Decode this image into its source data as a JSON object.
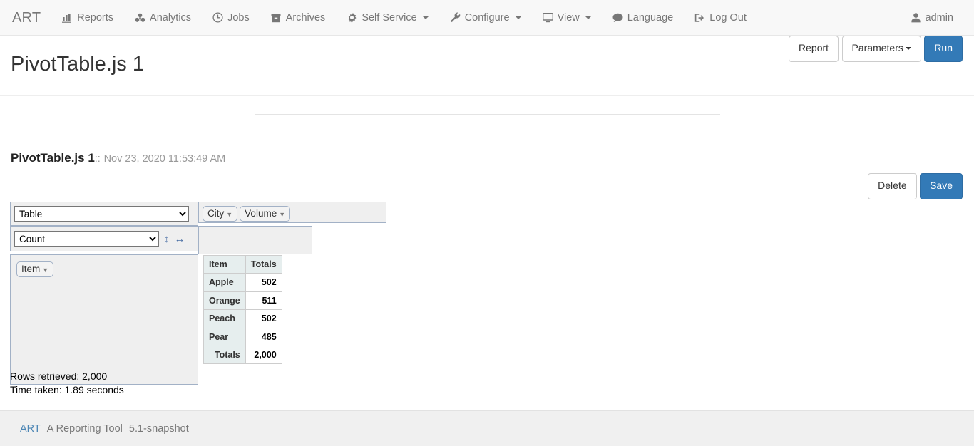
{
  "navbar": {
    "brand": "ART",
    "items": [
      {
        "label": "Reports",
        "icon": "bar-chart-icon",
        "caret": false
      },
      {
        "label": "Analytics",
        "icon": "cubes-icon",
        "caret": false
      },
      {
        "label": "Jobs",
        "icon": "clock-icon",
        "caret": false
      },
      {
        "label": "Archives",
        "icon": "archive-icon",
        "caret": false
      },
      {
        "label": "Self Service",
        "icon": "gear-icon",
        "caret": true
      },
      {
        "label": "Configure",
        "icon": "wrench-icon",
        "caret": true
      },
      {
        "label": "View",
        "icon": "desktop-icon",
        "caret": true
      },
      {
        "label": "Language",
        "icon": "comment-icon",
        "caret": false
      },
      {
        "label": "Log Out",
        "icon": "sign-out-icon",
        "caret": false
      }
    ],
    "user": {
      "label": "admin",
      "icon": "user-icon"
    }
  },
  "header": {
    "title": "PivotTable.js 1",
    "buttons": {
      "report": "Report",
      "parameters": "Parameters",
      "run": "Run"
    }
  },
  "report": {
    "name": "PivotTable.js 1",
    "separator": "::",
    "timestamp": "Nov 23, 2020 11:53:49 AM",
    "delete_label": "Delete",
    "save_label": "Save"
  },
  "pivot": {
    "renderer": {
      "selected": "Table",
      "options": [
        "Table"
      ]
    },
    "aggregator": {
      "selected": "Count",
      "options": [
        "Count"
      ]
    },
    "sort_icons": {
      "vertical": "↕",
      "horizontal": "↔"
    },
    "cols": [
      {
        "label": "City",
        "triangle": "▼"
      },
      {
        "label": "Volume",
        "triangle": "▼"
      }
    ],
    "rows": [
      {
        "label": "Item",
        "triangle": "▼"
      }
    ],
    "unused": []
  },
  "chart_data": {
    "type": "table",
    "title": "PivotTable.js 1",
    "columns": [
      "Item",
      "Totals"
    ],
    "categories": [
      "Apple",
      "Orange",
      "Peach",
      "Pear"
    ],
    "values": [
      502,
      511,
      502,
      485
    ],
    "rows": [
      {
        "label": "Apple",
        "total": "502"
      },
      {
        "label": "Orange",
        "total": "511"
      },
      {
        "label": "Peach",
        "total": "502"
      },
      {
        "label": "Pear",
        "total": "485"
      }
    ],
    "grand_total_label": "Totals",
    "grand_total": "2,000",
    "aggregator": "Count",
    "row_field": "Item"
  },
  "stats": {
    "rows_retrieved": "Rows retrieved: 2,000",
    "time_taken": "Time taken: 1.89 seconds"
  },
  "footer": {
    "brand": "ART",
    "tagline": "A Reporting Tool",
    "version": "5.1-snapshot"
  },
  "colors": {
    "navbar_bg": "#f8f8f8",
    "primary": "#337ab7",
    "muted_text": "#777777",
    "pivot_border": "#a2b1c6",
    "pivot_bg": "#efefef",
    "table_header_bg": "#e6eeee",
    "footer_bg": "#f0f0f0",
    "link": "#4c86b5"
  }
}
